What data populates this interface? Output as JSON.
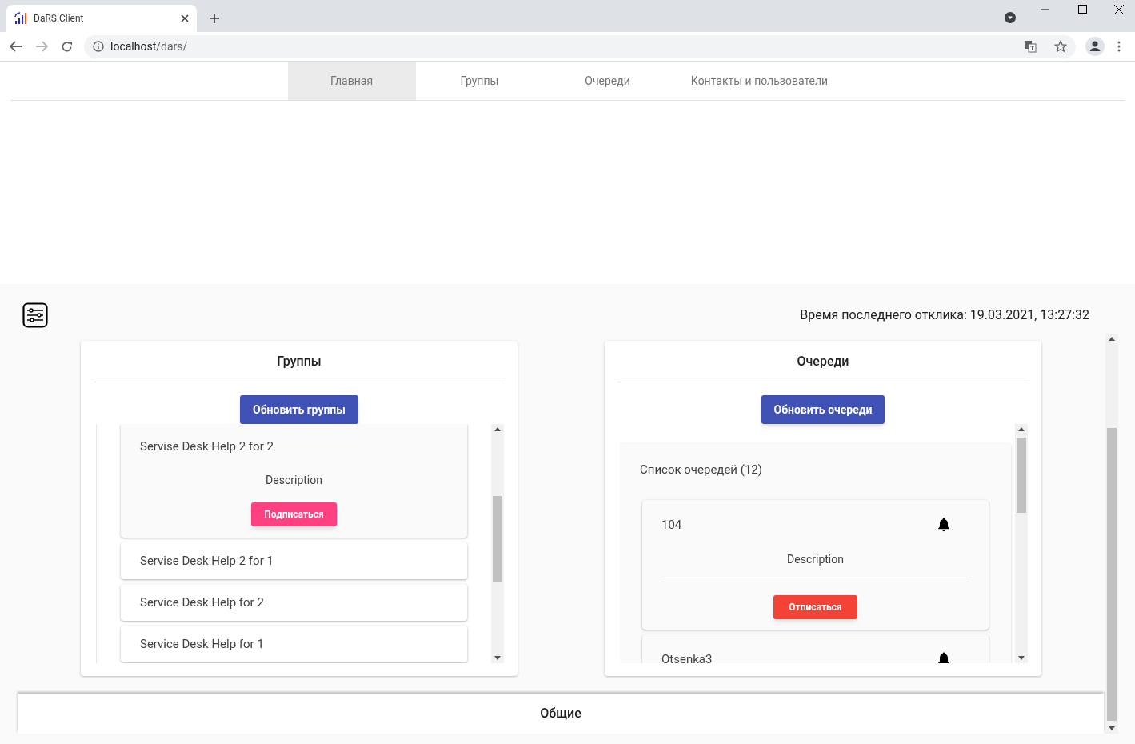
{
  "browser": {
    "tab_title": "DaRS Client",
    "url_host": "localhost",
    "url_path": "/dars/"
  },
  "nav": {
    "tabs": [
      {
        "label": "Главная",
        "selected": true
      },
      {
        "label": "Группы",
        "selected": false
      },
      {
        "label": "Очереди",
        "selected": false
      },
      {
        "label": "Контакты и пользователи",
        "selected": false
      }
    ]
  },
  "last_response": "Время последнего отклика: 19.03.2021, 13:27:32",
  "groups": {
    "title": "Группы",
    "refresh_button": "Обновить группы",
    "items": [
      {
        "name": "Servise Desk Help 2 for 2",
        "expanded": true,
        "description": "Description",
        "button": "Подписаться"
      },
      {
        "name": "Servise Desk Help 2 for 1",
        "expanded": false
      },
      {
        "name": "Service Desk Help for 2",
        "expanded": false
      },
      {
        "name": "Service Desk Help for 1",
        "expanded": false
      }
    ]
  },
  "queues": {
    "title": "Очереди",
    "refresh_button": "Обновить очереди",
    "list_title": "Список очередей (12)",
    "items": [
      {
        "name": "104",
        "expanded": true,
        "description": "Description",
        "button": "Отписаться"
      },
      {
        "name": "Otsenka3",
        "expanded": false
      }
    ]
  },
  "bottom_tab": "Общие"
}
